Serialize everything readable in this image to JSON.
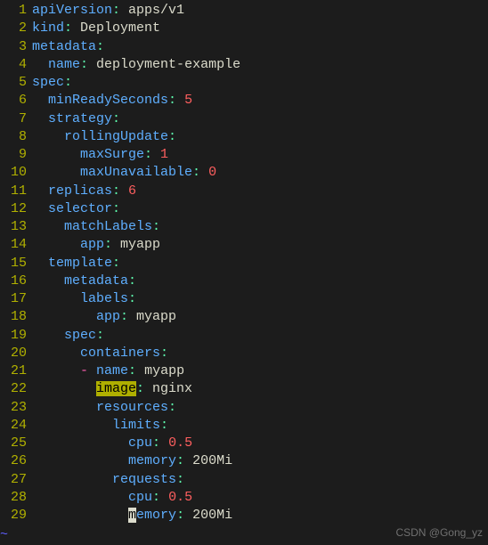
{
  "watermark": "CSDN @Gong_yz",
  "lines": [
    {
      "n": 1,
      "tokens": [
        {
          "c": "kw",
          "t": "apiVersion"
        },
        {
          "c": "col",
          "t": ": "
        },
        {
          "c": "str",
          "t": "apps/v1"
        }
      ]
    },
    {
      "n": 2,
      "tokens": [
        {
          "c": "kw",
          "t": "kind"
        },
        {
          "c": "col",
          "t": ": "
        },
        {
          "c": "str",
          "t": "Deployment"
        }
      ]
    },
    {
      "n": 3,
      "tokens": [
        {
          "c": "kw",
          "t": "metadata"
        },
        {
          "c": "col",
          "t": ":"
        }
      ]
    },
    {
      "n": 4,
      "indent": 2,
      "tokens": [
        {
          "c": "kw",
          "t": "name"
        },
        {
          "c": "col",
          "t": ": "
        },
        {
          "c": "str",
          "t": "deployment-example"
        }
      ]
    },
    {
      "n": 5,
      "tokens": [
        {
          "c": "kw",
          "t": "spec"
        },
        {
          "c": "col",
          "t": ":"
        }
      ]
    },
    {
      "n": 6,
      "indent": 2,
      "tokens": [
        {
          "c": "kw",
          "t": "minReadySeconds"
        },
        {
          "c": "col",
          "t": ": "
        },
        {
          "c": "num",
          "t": "5"
        }
      ]
    },
    {
      "n": 7,
      "indent": 2,
      "tokens": [
        {
          "c": "kw",
          "t": "strategy"
        },
        {
          "c": "col",
          "t": ":"
        }
      ]
    },
    {
      "n": 8,
      "indent": 4,
      "tokens": [
        {
          "c": "kw",
          "t": "rollingUpdate"
        },
        {
          "c": "col",
          "t": ":"
        }
      ]
    },
    {
      "n": 9,
      "indent": 6,
      "tokens": [
        {
          "c": "kw",
          "t": "maxSurge"
        },
        {
          "c": "col",
          "t": ": "
        },
        {
          "c": "num",
          "t": "1"
        }
      ]
    },
    {
      "n": 10,
      "indent": 6,
      "tokens": [
        {
          "c": "kw",
          "t": "maxUnavailable"
        },
        {
          "c": "col",
          "t": ": "
        },
        {
          "c": "num",
          "t": "0"
        }
      ]
    },
    {
      "n": 11,
      "indent": 2,
      "tokens": [
        {
          "c": "kw",
          "t": "replicas"
        },
        {
          "c": "col",
          "t": ": "
        },
        {
          "c": "num",
          "t": "6"
        }
      ]
    },
    {
      "n": 12,
      "indent": 2,
      "tokens": [
        {
          "c": "kw",
          "t": "selector"
        },
        {
          "c": "col",
          "t": ":"
        }
      ]
    },
    {
      "n": 13,
      "indent": 4,
      "tokens": [
        {
          "c": "kw",
          "t": "matchLabels"
        },
        {
          "c": "col",
          "t": ":"
        }
      ]
    },
    {
      "n": 14,
      "indent": 6,
      "tokens": [
        {
          "c": "kw",
          "t": "app"
        },
        {
          "c": "col",
          "t": ": "
        },
        {
          "c": "str",
          "t": "myapp"
        }
      ]
    },
    {
      "n": 15,
      "indent": 2,
      "tokens": [
        {
          "c": "kw",
          "t": "template"
        },
        {
          "c": "col",
          "t": ":"
        }
      ]
    },
    {
      "n": 16,
      "indent": 4,
      "tokens": [
        {
          "c": "kw",
          "t": "metadata"
        },
        {
          "c": "col",
          "t": ":"
        }
      ]
    },
    {
      "n": 17,
      "indent": 6,
      "tokens": [
        {
          "c": "kw",
          "t": "labels"
        },
        {
          "c": "col",
          "t": ":"
        }
      ]
    },
    {
      "n": 18,
      "indent": 8,
      "tokens": [
        {
          "c": "kw",
          "t": "app"
        },
        {
          "c": "col",
          "t": ": "
        },
        {
          "c": "str",
          "t": "myapp"
        }
      ]
    },
    {
      "n": 19,
      "indent": 4,
      "tokens": [
        {
          "c": "kw",
          "t": "spec"
        },
        {
          "c": "col",
          "t": ":"
        }
      ]
    },
    {
      "n": 20,
      "indent": 6,
      "tokens": [
        {
          "c": "kw",
          "t": "containers"
        },
        {
          "c": "col",
          "t": ":"
        }
      ]
    },
    {
      "n": 21,
      "indent": 6,
      "tokens": [
        {
          "c": "dash",
          "t": "- "
        },
        {
          "c": "kw",
          "t": "name"
        },
        {
          "c": "col",
          "t": ": "
        },
        {
          "c": "str",
          "t": "myapp"
        }
      ]
    },
    {
      "n": 22,
      "indent": 8,
      "tokens": [
        {
          "c": "hl",
          "t": "image"
        },
        {
          "c": "col",
          "t": ": "
        },
        {
          "c": "str",
          "t": "nginx"
        }
      ]
    },
    {
      "n": 23,
      "indent": 8,
      "tokens": [
        {
          "c": "kw",
          "t": "resources"
        },
        {
          "c": "col",
          "t": ":"
        }
      ]
    },
    {
      "n": 24,
      "indent": 10,
      "tokens": [
        {
          "c": "kw",
          "t": "limits"
        },
        {
          "c": "col",
          "t": ":"
        }
      ]
    },
    {
      "n": 25,
      "indent": 12,
      "tokens": [
        {
          "c": "kw",
          "t": "cpu"
        },
        {
          "c": "col",
          "t": ": "
        },
        {
          "c": "num",
          "t": "0.5"
        }
      ]
    },
    {
      "n": 26,
      "indent": 12,
      "tokens": [
        {
          "c": "kw",
          "t": "memory"
        },
        {
          "c": "col",
          "t": ": "
        },
        {
          "c": "str",
          "t": "200Mi"
        }
      ]
    },
    {
      "n": 27,
      "indent": 10,
      "tokens": [
        {
          "c": "kw",
          "t": "requests"
        },
        {
          "c": "col",
          "t": ":"
        }
      ]
    },
    {
      "n": 28,
      "indent": 12,
      "tokens": [
        {
          "c": "kw",
          "t": "cpu"
        },
        {
          "c": "col",
          "t": ": "
        },
        {
          "c": "num",
          "t": "0.5"
        }
      ]
    },
    {
      "n": 29,
      "indent": 12,
      "tokens": [
        {
          "c": "cur",
          "t": "m"
        },
        {
          "c": "kw",
          "t": "emory"
        },
        {
          "c": "col",
          "t": ": "
        },
        {
          "c": "str",
          "t": "200Mi"
        }
      ]
    }
  ],
  "tilde": "~"
}
